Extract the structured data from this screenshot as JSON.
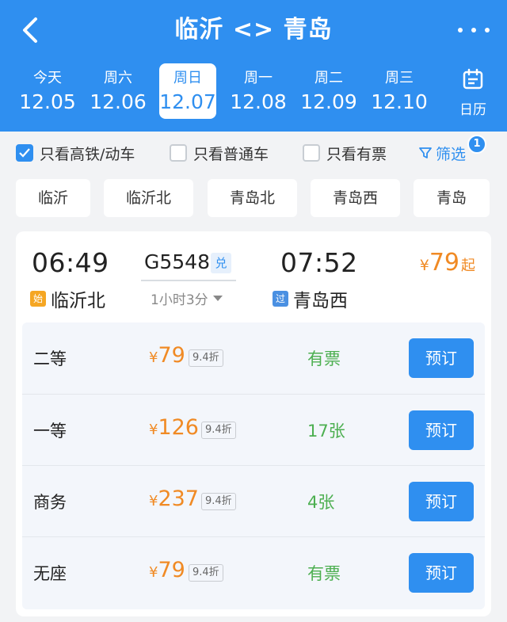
{
  "header": {
    "title": "临沂 <> 青岛",
    "dates": [
      {
        "weekday": "今天",
        "date": "12.05",
        "active": false
      },
      {
        "weekday": "周六",
        "date": "12.06",
        "active": false
      },
      {
        "weekday": "周日",
        "date": "12.07",
        "active": true
      },
      {
        "weekday": "周一",
        "date": "12.08",
        "active": false
      },
      {
        "weekday": "周二",
        "date": "12.09",
        "active": false
      },
      {
        "weekday": "周三",
        "date": "12.10",
        "active": false
      }
    ],
    "calendar_label": "日历"
  },
  "filters": {
    "high_speed": {
      "label": "只看高铁/动车",
      "checked": true
    },
    "normal": {
      "label": "只看普通车",
      "checked": false
    },
    "available": {
      "label": "只看有票",
      "checked": false
    },
    "screen_label": "筛选",
    "screen_badge": "1"
  },
  "stations": [
    "临沂",
    "临沂北",
    "青岛北",
    "青岛西",
    "青岛"
  ],
  "train": {
    "dep_time": "06:49",
    "arr_time": "07:52",
    "number": "G5548",
    "tag": "兑",
    "duration": "1小时3分",
    "from_tag": "始",
    "from_station": "临沂北",
    "to_tag": "过",
    "to_station": "青岛西",
    "min_price_symbol": "¥",
    "min_price": "79",
    "min_price_suffix": "起",
    "seats": [
      {
        "name": "二等",
        "symbol": "¥",
        "price": "79",
        "discount": "9.4折",
        "availability": "有票",
        "button": "预订"
      },
      {
        "name": "一等",
        "symbol": "¥",
        "price": "126",
        "discount": "9.4折",
        "availability": "17张",
        "button": "预订"
      },
      {
        "name": "商务",
        "symbol": "¥",
        "price": "237",
        "discount": "9.4折",
        "availability": "4张",
        "button": "预订"
      },
      {
        "name": "无座",
        "symbol": "¥",
        "price": "79",
        "discount": "9.4折",
        "availability": "有票",
        "button": "预订"
      }
    ]
  },
  "colors": {
    "brand_blue": "#2f8ff0",
    "price_orange": "#f08a24",
    "available_green": "#4caf50"
  }
}
